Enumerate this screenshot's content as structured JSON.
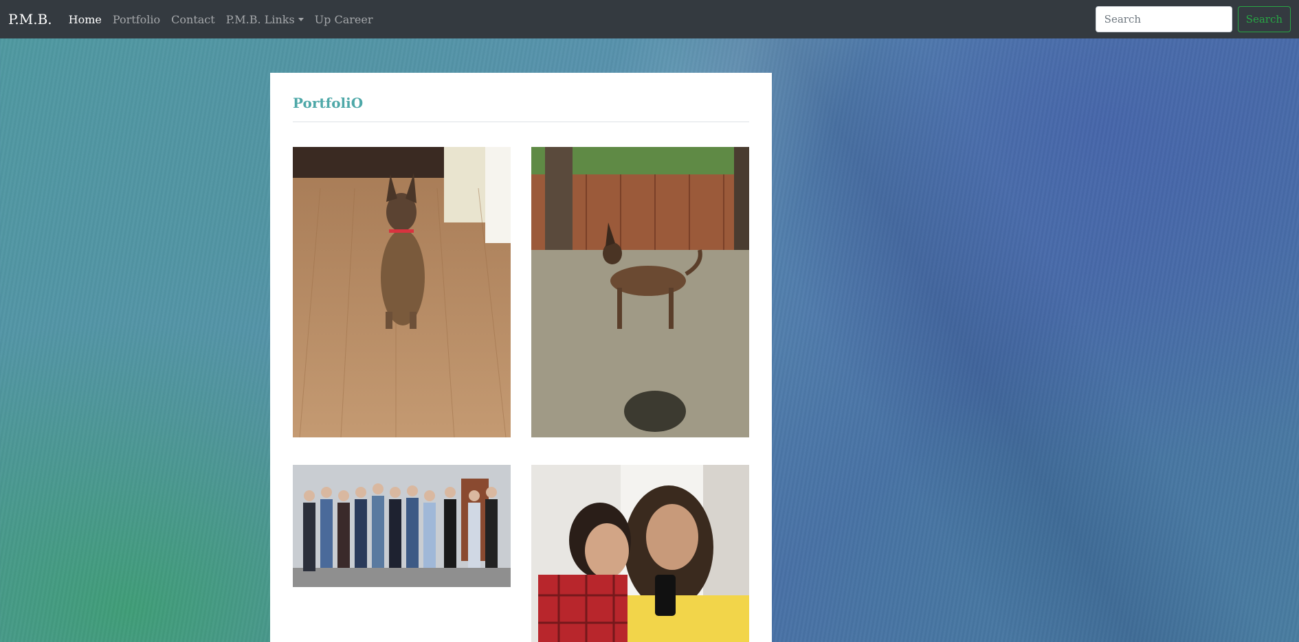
{
  "navbar": {
    "brand": "P.M.B.",
    "items": [
      {
        "label": "Home",
        "active": true
      },
      {
        "label": "Portfolio",
        "active": false
      },
      {
        "label": "Contact",
        "active": false
      },
      {
        "label": "P.M.B. Links",
        "active": false,
        "dropdown": true
      },
      {
        "label": "Up Career",
        "active": false
      }
    ],
    "search": {
      "placeholder": "Search",
      "button_label": "Search"
    }
  },
  "portfolio": {
    "title": "PortfoliO",
    "photos": [
      {
        "icon": "dog-indoors-photo"
      },
      {
        "icon": "dog-yard-photo"
      },
      {
        "icon": "group-photo"
      },
      {
        "icon": "couple-selfie-photo"
      }
    ]
  },
  "colors": {
    "navbar_bg": "#343a40",
    "title": "#4ea8a8",
    "search_button": "#28a745"
  }
}
